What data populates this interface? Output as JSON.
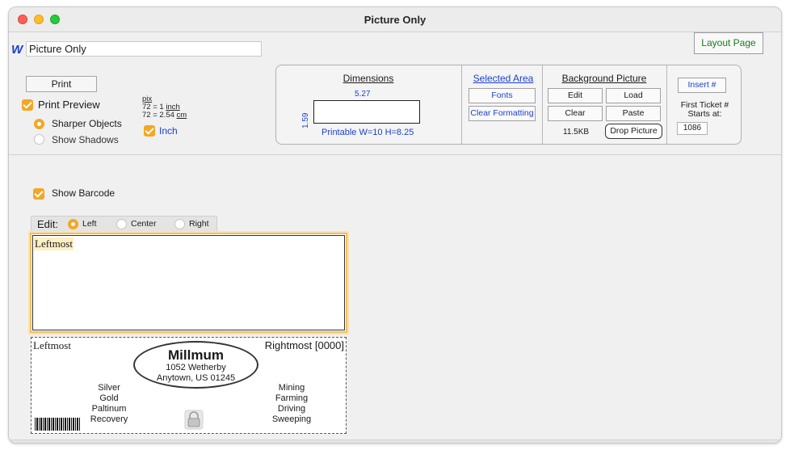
{
  "window": {
    "title": "Picture Only"
  },
  "document": {
    "icon": "w-icon",
    "name": "Picture Only"
  },
  "layout_page_button": "Layout Page",
  "print": {
    "button": "Print",
    "preview_label": "Print Preview",
    "preview_checked": true,
    "sharper_objects": "Sharper Objects",
    "show_shadows": "Show Shadows",
    "selected_mode": "Sharper Objects"
  },
  "scale": {
    "pix": "pix",
    "line1_prefix": "72 = 1 ",
    "line1_unit": "inch",
    "line2_prefix": "72 = 2.54 ",
    "line2_unit": "cm",
    "inch_label": "Inch",
    "inch_checked": true
  },
  "dimensions": {
    "header": "Dimensions",
    "width": "5.27",
    "height": "1.59",
    "printable": "Printable W=10 H=8.25"
  },
  "selected_area": {
    "header": "Selected Area",
    "fonts": "Fonts",
    "clear_formatting": "Clear Formatting"
  },
  "background_picture": {
    "header": "Background Picture",
    "edit": "Edit",
    "load": "Load",
    "clear": "Clear",
    "paste": "Paste",
    "size": "11.5KB",
    "drop": "Drop Picture"
  },
  "ticket_number": {
    "insert": "Insert #",
    "first_label_1": "First Ticket #",
    "first_label_2": "Starts at:",
    "start": "1086"
  },
  "barcode_option": {
    "label": "Show Barcode",
    "checked": true
  },
  "edit_align": {
    "label": "Edit:",
    "left": "Left",
    "center": "Center",
    "right": "Right",
    "selected": "Left"
  },
  "editor": {
    "text": "Leftmost"
  },
  "ticket": {
    "leftmost": "Leftmost",
    "rightmost": "Rightmost [0000]",
    "name": "Millmum",
    "address1": "1052 Wetherby",
    "address2": "Anytown, US 01245",
    "left_list": [
      "Silver",
      "Gold",
      "Paltinum",
      "Recovery"
    ],
    "right_list": [
      "Mining",
      "Farming",
      "Driving",
      "Sweeping"
    ]
  },
  "colors": {
    "accent": "#f5a623",
    "link_blue": "#1a3fd1",
    "green": "#1c7a1c"
  }
}
